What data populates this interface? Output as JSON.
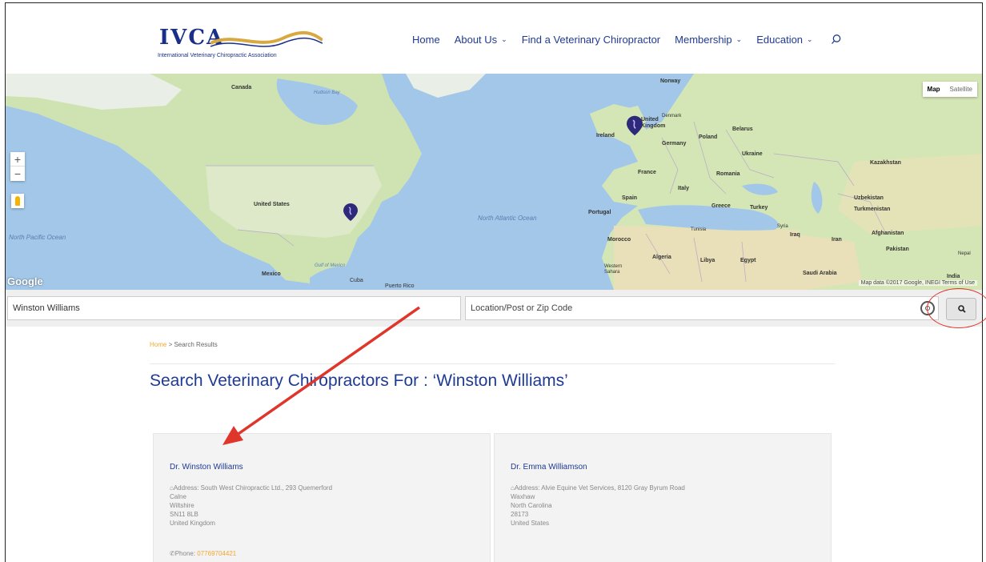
{
  "logo": {
    "letters": "IVCA",
    "tagline": "International Veterinary Chiropractic Association"
  },
  "nav": {
    "items": [
      {
        "label": "Home",
        "has_dropdown": false
      },
      {
        "label": "About Us",
        "has_dropdown": true
      },
      {
        "label": "Find a Veterinary Chiropractor",
        "has_dropdown": false
      },
      {
        "label": "Membership",
        "has_dropdown": true
      },
      {
        "label": "Education",
        "has_dropdown": true
      }
    ],
    "dropdown_glyph": "⌄",
    "search_icon": "search-icon"
  },
  "map": {
    "type_active": "Map",
    "type_inactive": "Satellite",
    "zoom_in": "+",
    "zoom_out": "−",
    "google": "Google",
    "credit": "Map data ©2017 Google, INEGI   Terms of Use",
    "labels": {
      "canada": "Canada",
      "hudson_bay": "Hudson Bay",
      "united_states": "United States",
      "mexico": "Mexico",
      "gulf": "Gulf of Mexico",
      "cuba": "Cuba",
      "puerto_rico": "Puerto Rico",
      "north_atlantic": "North Atlantic Ocean",
      "north_pacific": "North Pacific Ocean",
      "norway": "Norway",
      "denmark": "Denmark",
      "ireland": "Ireland",
      "united_kingdom": "United Kingdom",
      "poland": "Poland",
      "belarus": "Belarus",
      "germany": "Germany",
      "ukraine": "Ukraine",
      "france": "France",
      "romania": "Romania",
      "italy": "Italy",
      "spain": "Spain",
      "portugal": "Portugal",
      "greece": "Greece",
      "turkey": "Turkey",
      "kazakhstan": "Kazakhstan",
      "uzbekistan": "Uzbekistan",
      "turkmenistan": "Turkmenistan",
      "afghanistan": "Afghanistan",
      "pakistan": "Pakistan",
      "iran": "Iran",
      "iraq": "Iraq",
      "syria": "Syria",
      "morocco": "Morocco",
      "algeria": "Algeria",
      "libya": "Libya",
      "egypt": "Egypt",
      "saudi_arabia": "Saudi Arabia",
      "tunisia": "Tunisia",
      "western_sahara": "Western Sahara",
      "india": "India",
      "nepal": "Nepal"
    }
  },
  "search": {
    "name_value": "Winston Williams",
    "location_placeholder": "Location/Post or Zip Code"
  },
  "breadcrumb": {
    "home": "Home",
    "separator": " > ",
    "current": "Search Results"
  },
  "page_title": "Search Veterinary Chiropractors For : ‘Winston Williams’",
  "results": [
    {
      "name": "Dr. Winston Williams",
      "address_lines": [
        "Address: South West Chiropractic Ltd., 293 Quemerford",
        "Calne",
        "Wiltshire",
        "SN11 8LB",
        "United Kingdom"
      ],
      "phone_label": "Phone: ",
      "phone": "07769704421"
    },
    {
      "name": "Dr. Emma Williamson",
      "address_lines": [
        "Address: Alvie Equine Vet Services, 8120 Gray Byrum Road",
        "Waxhaw",
        "North Carolina",
        "28173",
        "United States"
      ]
    }
  ],
  "colors": {
    "brand_blue": "#1f3a93",
    "accent_orange": "#f0a830",
    "annotation_red": "#e0352b"
  }
}
